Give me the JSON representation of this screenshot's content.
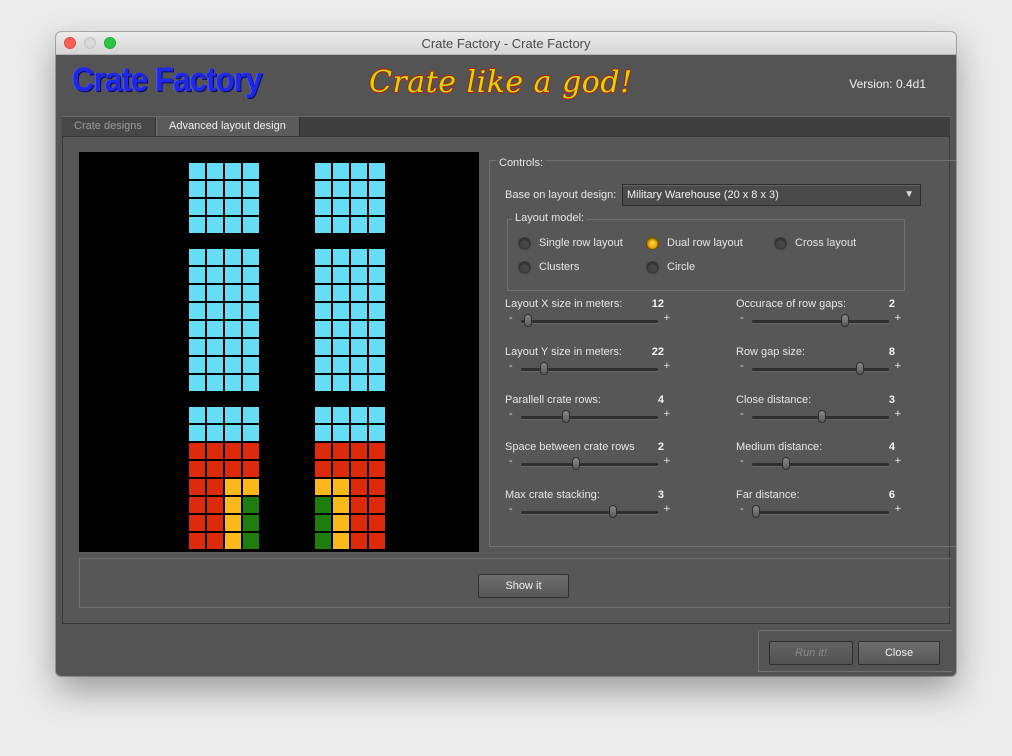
{
  "window": {
    "title": "Crate Factory - Crate Factory"
  },
  "header": {
    "app_name": "Crate Factory",
    "tagline": "Crate like a god!",
    "version": "Version: 0.4d1"
  },
  "tabs": [
    {
      "label": "Crate designs",
      "selected": false
    },
    {
      "label": "Advanced layout design",
      "selected": true
    }
  ],
  "controls": {
    "legend": "Controls:",
    "base_label": "Base on layout design:",
    "base_value": "Military Warehouse (20 x 8 x 3)",
    "layout_model": {
      "legend": "Layout model:",
      "options": [
        {
          "label": "Single row layout",
          "selected": false
        },
        {
          "label": "Dual row layout",
          "selected": true
        },
        {
          "label": "Cross layout",
          "selected": false
        },
        {
          "label": "Clusters",
          "selected": false
        },
        {
          "label": "Circle",
          "selected": false
        }
      ]
    },
    "sliders": [
      {
        "label": "Layout X size in meters:",
        "value": "12",
        "level": 0.05
      },
      {
        "label": "Occurace of row gaps:",
        "value": "2",
        "level": 0.68
      },
      {
        "label": "Layout Y size in meters:",
        "value": "22",
        "level": 0.17
      },
      {
        "label": "Row gap size:",
        "value": "8",
        "level": 0.79
      },
      {
        "label": "Parallell crate rows:",
        "value": "4",
        "level": 0.33
      },
      {
        "label": "Close distance:",
        "value": "3",
        "level": 0.51
      },
      {
        "label": "Space between crate rows",
        "value": "2",
        "level": 0.4
      },
      {
        "label": "Medium distance:",
        "value": "4",
        "level": 0.25
      },
      {
        "label": "Max crate stacking:",
        "value": "3",
        "level": 0.67
      },
      {
        "label": "Far distance:",
        "value": "6",
        "level": 0.03
      }
    ]
  },
  "buttons": {
    "show_it": "Show it",
    "run_it": "Run it!",
    "close": "Close"
  },
  "colors": {
    "crate_empty": "#66ddf5",
    "crate_level1": "#dd2a0c",
    "crate_level2": "#f9b81b",
    "crate_level3": "#1e7d0c"
  }
}
